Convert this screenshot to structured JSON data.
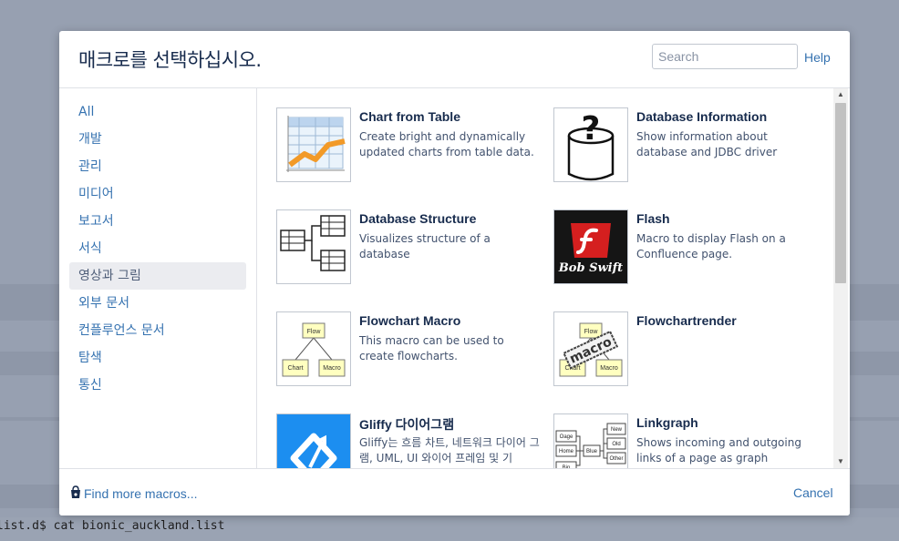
{
  "background": {
    "terminal_line": "list.d$ cat bionic_auckland.list"
  },
  "dialog": {
    "title": "매크로를 선택하십시오.",
    "search_placeholder": "Search",
    "help_label": "Help"
  },
  "sidebar": {
    "categories": [
      {
        "label": "All"
      },
      {
        "label": "개발"
      },
      {
        "label": "관리"
      },
      {
        "label": "미디어"
      },
      {
        "label": "보고서"
      },
      {
        "label": "서식"
      },
      {
        "label": "영상과 그림"
      },
      {
        "label": "외부 문서"
      },
      {
        "label": "컨플루언스 문서"
      },
      {
        "label": "탐색"
      },
      {
        "label": "통신"
      }
    ],
    "active_index": 6
  },
  "macros": [
    {
      "title": "Chart from Table",
      "desc": "Create bright and dynamically updated charts from table data.",
      "icon": "chart-table-icon"
    },
    {
      "title": "Database Information",
      "desc": "Show information about database and JDBC driver",
      "icon": "database-question-icon"
    },
    {
      "title": "Database Structure",
      "desc": "Visualizes structure of a database",
      "icon": "database-structure-icon"
    },
    {
      "title": "Flash",
      "desc": "Macro to display Flash on a Confluence page.",
      "icon": "flash-icon",
      "logo_text": "Bob Swift"
    },
    {
      "title": "Flowchart Macro",
      "desc": "This macro can be used to create flowcharts.",
      "icon": "flowchart-icon",
      "nodes": [
        "Flow",
        "Chart",
        "Macro"
      ]
    },
    {
      "title": "Flowchartrender",
      "desc": "",
      "icon": "flowchartrender-icon",
      "nodes": [
        "Flow",
        "Chart",
        "Macro"
      ],
      "stamp": "macro"
    },
    {
      "title": "Gliffy 다이어그램",
      "desc": "Gliffy는 흐름 차트, 네트워크 다이어 그램, UML, UI 와이어 프레임 및 기",
      "icon": "gliffy-icon"
    },
    {
      "title": "Linkgraph",
      "desc": "Shows incoming and outgoing links of a page as graph",
      "icon": "linkgraph-icon",
      "nodes": [
        "Oage",
        "Home",
        "Blue",
        "Bin",
        "New",
        "Old",
        "Other"
      ]
    }
  ],
  "footer": {
    "find_more_label": "Find more macros...",
    "cancel_label": "Cancel"
  },
  "colors": {
    "link": "#3572b0",
    "heading": "#172b4d",
    "overlay": "#97a0b1",
    "flash_red": "#d51f1f",
    "gliffy_blue": "#1c8ef0"
  }
}
